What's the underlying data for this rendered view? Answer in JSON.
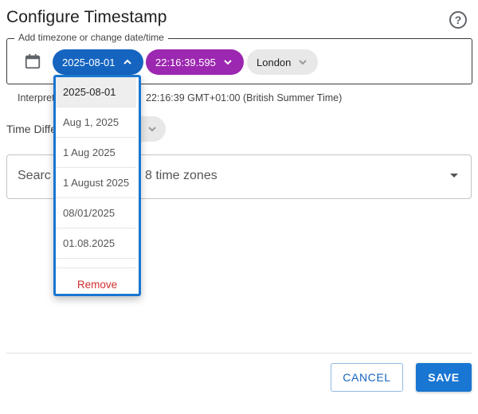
{
  "dialog": {
    "title": "Configure Timestamp",
    "help_icon": "help-circle-icon"
  },
  "field": {
    "legend": "Add timezone or change date/time",
    "calendar_icon": "calendar-icon",
    "date_chip": "2025-08-01",
    "time_chip": "22:16:39.595",
    "timezone_chip": "London"
  },
  "interpretation": {
    "prefix": "Interpret",
    "value": "22:16:39 GMT+01:00 (British Summer Time)"
  },
  "time_difference": {
    "label": "Time Diffe"
  },
  "search": {
    "placeholder_start": "Searc",
    "placeholder_end": "8 time zones"
  },
  "date_format_menu": {
    "options": [
      "2025-08-01",
      "Aug 1, 2025",
      "1 Aug 2025",
      "1 August 2025",
      "08/01/2025",
      "01.08.2025"
    ],
    "selected": "2025-08-01",
    "remove_label": "Remove"
  },
  "actions": {
    "cancel": "CANCEL",
    "save": "SAVE"
  },
  "colors": {
    "date_chip": "#1565c0",
    "time_chip": "#9c27b0",
    "timezone_chip": "#e8e8e8",
    "primary": "#1976d2",
    "remove": "#d32f2f"
  }
}
